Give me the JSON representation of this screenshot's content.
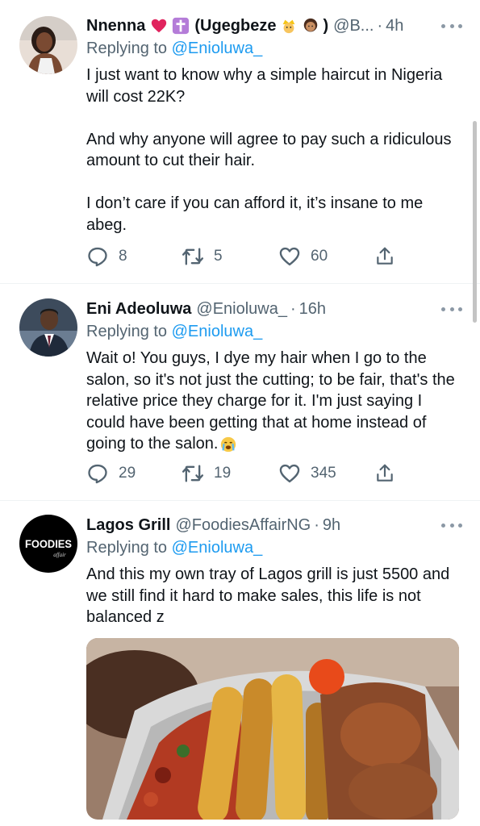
{
  "tweets": [
    {
      "name": "Nnenna",
      "name_suffix": "(Ugegbeze",
      "handle": "@B...",
      "time": "4h",
      "replying_label": "Replying to",
      "replying_to": "@Enioluwa_",
      "text": "I just want to know why a simple haircut in Nigeria will cost 22K?\n\nAnd why anyone will agree to pay such a ridiculous amount to cut their hair.\n\nI don’t care if you can afford it, it’s insane to me abeg.",
      "replies": "8",
      "retweets": "5",
      "likes": "60"
    },
    {
      "name": "Eni Adeoluwa",
      "handle": "@Enioluwa_",
      "time": "16h",
      "replying_label": "Replying to",
      "replying_to": "@Enioluwa_",
      "text": "Wait o! You guys, I dye my hair when I go to the salon, so it's not just the cutting; to be fair, that's the relative price they charge for it. I'm just saying I could have been getting that at home instead of going to the salon.",
      "replies": "29",
      "retweets": "19",
      "likes": "345"
    },
    {
      "name": "Lagos Grill",
      "handle": "@FoodiesAffairNG",
      "time": "9h",
      "replying_label": "Replying to",
      "replying_to": "@Enioluwa_",
      "text": "And this my own tray of Lagos grill is just 5500 and we still find it hard to make sales, this life is not balanced z",
      "avatar_text": "FOODIES",
      "avatar_subtext": "affair"
    }
  ],
  "colors": {
    "text": "#0f1419",
    "secondary": "#536471",
    "link": "#1d9bf0",
    "divider": "#eff3f4"
  }
}
